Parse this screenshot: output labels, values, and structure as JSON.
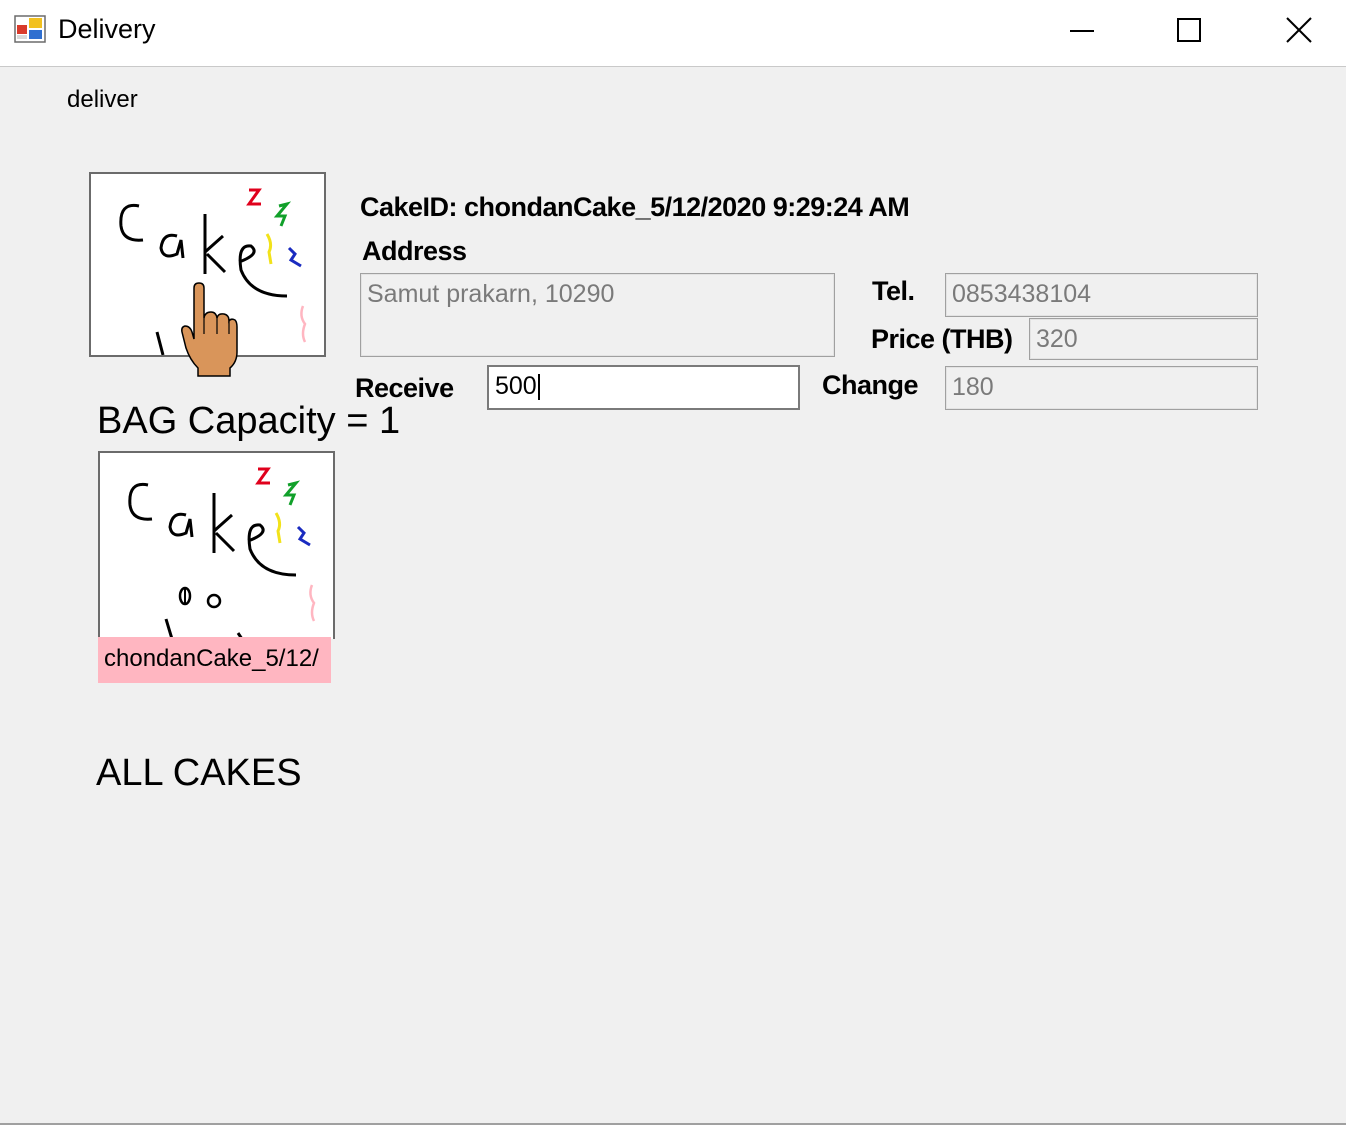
{
  "window": {
    "title": "Delivery",
    "app_icon": "winforms-app-icon",
    "controls": [
      "minimize-icon",
      "maximize-icon",
      "close-icon"
    ]
  },
  "menu": {
    "items": [
      {
        "label": "deliver"
      }
    ]
  },
  "cake_detail": {
    "cake_id_label": "CakeID: chondanCake_5/12/2020 9:29:24 AM",
    "address_label": "Address",
    "address_value": "Samut prakarn, 10290",
    "tel_label": "Tel.",
    "tel_value": "0853438104",
    "price_label": "Price (THB)",
    "price_value": "320",
    "receive_label": "Receive",
    "receive_value": "500",
    "change_label": "Change",
    "change_value": "180",
    "cursor": "hand-pointer-icon"
  },
  "bag": {
    "heading": "BAG  Capacity = 1",
    "items": [
      {
        "caption": "chondanCake_5/12/"
      }
    ]
  },
  "all_cakes": {
    "heading": "ALL CAKES",
    "items": []
  }
}
